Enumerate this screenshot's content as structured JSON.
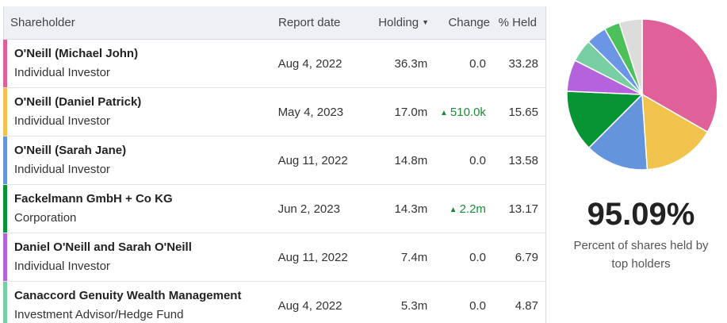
{
  "headers": {
    "shareholder": "Shareholder",
    "report_date": "Report date",
    "holding": "Holding",
    "change": "Change",
    "pct_held": "% Held"
  },
  "rows": [
    {
      "name": "O'Neill (Michael John)",
      "type": "Individual Investor",
      "date": "Aug 4, 2022",
      "holding": "36.3m",
      "change": "0.0",
      "change_up": false,
      "pct": "33.28",
      "color": "#e0609a"
    },
    {
      "name": "O'Neill (Daniel Patrick)",
      "type": "Individual Investor",
      "date": "May 4, 2023",
      "holding": "17.0m",
      "change": "510.0k",
      "change_up": true,
      "pct": "15.65",
      "color": "#f0c44c"
    },
    {
      "name": "O'Neill (Sarah Jane)",
      "type": "Individual Investor",
      "date": "Aug 11, 2022",
      "holding": "14.8m",
      "change": "0.0",
      "change_up": false,
      "pct": "13.58",
      "color": "#6495dc"
    },
    {
      "name": "Fackelmann GmbH + Co KG",
      "type": "Corporation",
      "date": "Jun 2, 2023",
      "holding": "14.3m",
      "change": "2.2m",
      "change_up": true,
      "pct": "13.17",
      "color": "#069435"
    },
    {
      "name": "Daniel O'Neill and Sarah O'Neill",
      "type": "Individual Investor",
      "date": "Aug 11, 2022",
      "holding": "7.4m",
      "change": "0.0",
      "change_up": false,
      "pct": "6.79",
      "color": "#b463dc"
    },
    {
      "name": "Canaccord Genuity Wealth Management",
      "type": "Investment Advisor/Hedge Fund",
      "date": "Aug 4, 2022",
      "holding": "5.3m",
      "change": "0.0",
      "change_up": false,
      "pct": "4.87",
      "color": "#78cfa3"
    }
  ],
  "summary": {
    "total_pct": "95.09%",
    "caption_line1": "Percent of shares held by",
    "caption_line2": "top holders"
  },
  "chart_data": {
    "type": "pie",
    "slices": [
      {
        "value": 33.28,
        "color": "#e0609a"
      },
      {
        "value": 15.65,
        "color": "#f0c44c"
      },
      {
        "value": 13.58,
        "color": "#6495dc"
      },
      {
        "value": 13.17,
        "color": "#069435"
      },
      {
        "value": 6.79,
        "color": "#b463dc"
      },
      {
        "value": 4.87,
        "color": "#78cfa3"
      },
      {
        "value": 4.4,
        "color": "#6b96e6"
      },
      {
        "value": 3.35,
        "color": "#4cc15a"
      },
      {
        "value": 4.91,
        "color": "#dcdcdc"
      }
    ]
  }
}
